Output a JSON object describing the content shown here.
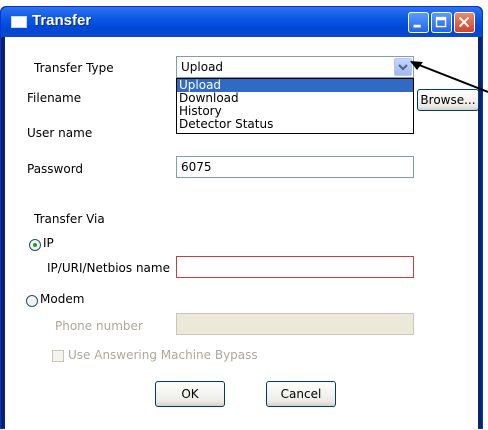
{
  "window": {
    "title": "Transfer"
  },
  "form": {
    "transfer_type_label": "Transfer Type",
    "transfer_type_value": "Upload",
    "transfer_type_options": [
      "Upload",
      "Download",
      "History",
      "Detector Status"
    ],
    "filename_label": "Filename",
    "browse_label": "Browse...",
    "username_label": "User name",
    "password_label": "Password",
    "password_value": "6075",
    "transfer_via_label": "Transfer Via",
    "ip_radio_label": "IP",
    "ip_name_label": "IP/URI/Netbios name",
    "ip_name_value": "",
    "modem_radio_label": "Modem",
    "phone_label": "Phone number",
    "phone_value": "",
    "bypass_label": "Use Answering Machine Bypass",
    "ok_label": "OK",
    "cancel_label": "Cancel"
  },
  "state": {
    "selected_option": "Upload",
    "via": "IP",
    "bypass_checked": false
  },
  "colors": {
    "titlebar": "#0a58e3",
    "selection": "#316ac5",
    "error_border": "#d23b3b"
  }
}
